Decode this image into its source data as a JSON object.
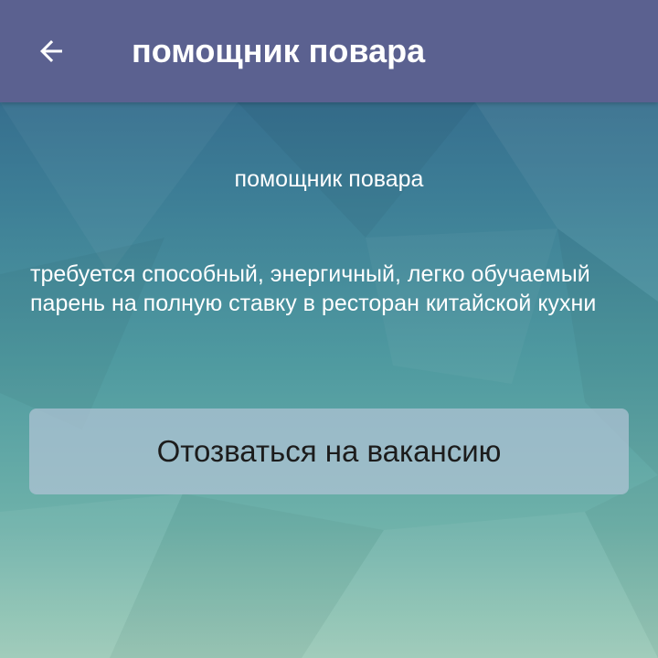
{
  "app_bar": {
    "title": "помощник повара",
    "back_icon": "arrow-left-icon",
    "color": "#5b6190"
  },
  "vacancy": {
    "title": "помощник повара",
    "description": "требуется способный, энергичный, легко обучаемый парень на полную ставку в ресторан китайской кухни"
  },
  "actions": {
    "apply_label": "Отозваться на вакансию"
  }
}
